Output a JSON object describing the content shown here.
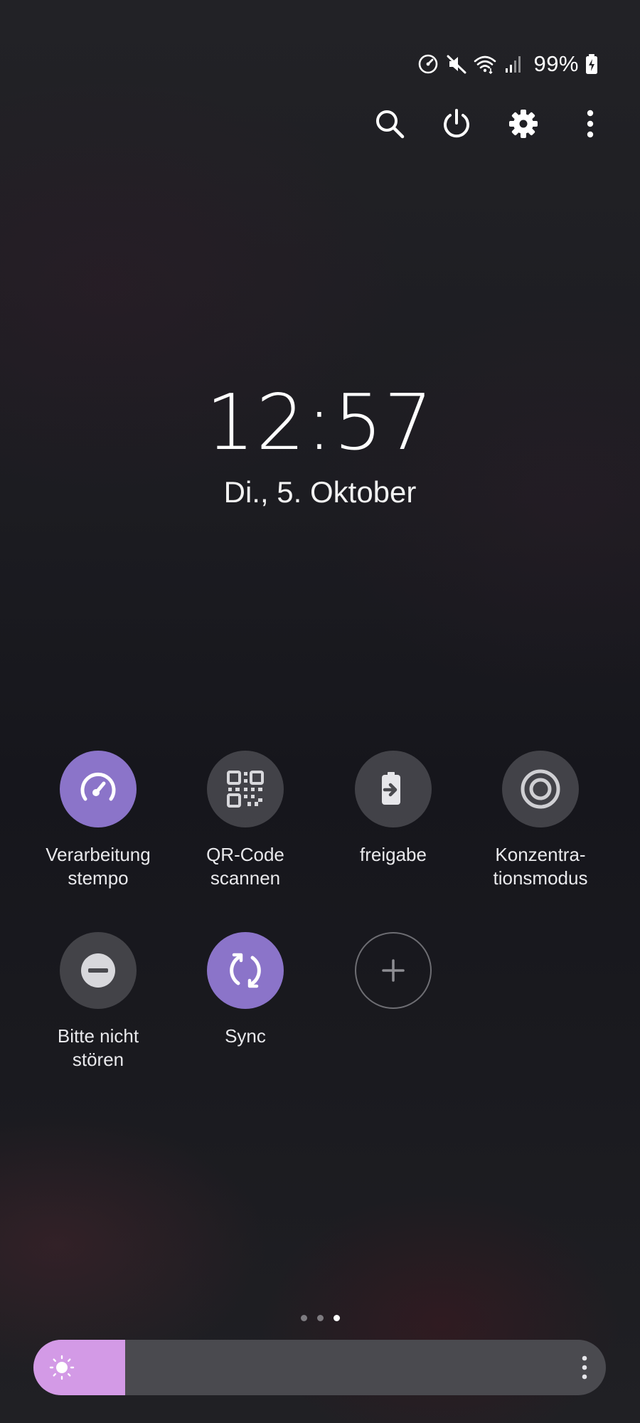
{
  "status_bar": {
    "icons": [
      "speed-icon",
      "mute-icon",
      "wifi-icon",
      "signal-icon",
      "battery-charging-icon"
    ],
    "battery_percent": "99%"
  },
  "top_actions": [
    "search-icon",
    "power-icon",
    "settings-icon",
    "more-vert-icon"
  ],
  "clock": {
    "time": "12:57",
    "date": "Di., 5. Oktober"
  },
  "tiles": [
    {
      "label": "Verarbeitung\nstempo",
      "icon": "speedometer-icon",
      "state": "on"
    },
    {
      "label": "QR-Code\nscannen",
      "icon": "qr-code-icon",
      "state": "off"
    },
    {
      "label": "freigabe",
      "icon": "share-file-icon",
      "state": "off"
    },
    {
      "label": "Konzentra-\ntionsmodus",
      "icon": "focus-target-icon",
      "state": "off"
    },
    {
      "label": "Bitte nicht\nstören",
      "icon": "do-not-disturb-icon",
      "state": "off"
    },
    {
      "label": "Sync",
      "icon": "sync-icon",
      "state": "on"
    },
    {
      "label": "",
      "icon": "add-icon",
      "state": "add"
    }
  ],
  "page_indicator": {
    "pages": 3,
    "current": 3
  },
  "brightness": {
    "level": 0.16,
    "icon": "sun-icon"
  },
  "colors": {
    "tile_active": "#8b74c9",
    "tile_inactive": "#505054",
    "brightness_fill": "#d39ae6",
    "brightness_track": "#4a4a4f"
  }
}
